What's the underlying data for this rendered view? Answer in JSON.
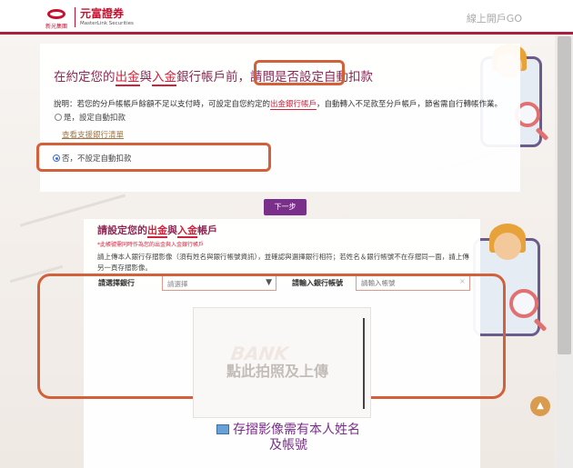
{
  "header": {
    "logo_small": "新光集團",
    "logo_zh": "元富證券",
    "logo_en": "MasterLink Securities",
    "link": "線上開戶GO"
  },
  "auto_debit": {
    "title_pre": "在約定您的",
    "title_out": "出金",
    "title_mid": "與",
    "title_in": "入金",
    "title_post": "銀行帳戶前，請問是否設定自動扣款",
    "desc_pre": "說明：若您的分戶帳帳戶餘額不足以支付時，可設定自您約定的",
    "desc_red": "出金銀行帳戶",
    "desc_post": "，自動轉入不足款至分戶帳戶，節省需自行轉帳作業。",
    "option_yes": "是，設定自動扣款",
    "bank_list_link": "查看支援銀行清單",
    "option_no": "否，不設定自動扣款",
    "selected": "no"
  },
  "next_button": "下一步",
  "bank_account": {
    "title_pre": "請設定您的",
    "title_out": "出金",
    "title_mid": "與",
    "title_in": "入金",
    "title_post": "帳戶",
    "note_red": "*此帳號需同時作為您的出金與入金銀行帳戶",
    "instruction": "請上傳本人銀行存摺影像（須有姓名與銀行帳號資訊），並確認與選擇銀行相符；若姓名＆銀行帳號不在存摺同一面，請上傳另一頁存摺影像。",
    "bank_label": "請選擇銀行",
    "bank_select_value": "請選擇",
    "account_label": "請輸入銀行帳號",
    "account_placeholder": "請輸入帳號",
    "upload_watermark": "BANK",
    "upload_text": "點此拍照及上傳",
    "caption": "存摺影像需有本人姓名及帳號"
  },
  "colors": {
    "brand_red": "#c8102e",
    "accent_purple": "#7a2f8a",
    "highlight_box": "#d2603a"
  }
}
